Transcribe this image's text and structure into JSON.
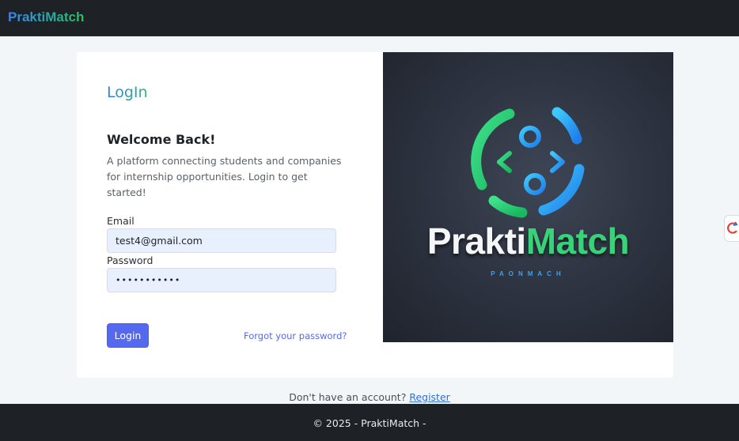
{
  "navbar": {
    "brand": "PraktiMatch"
  },
  "login": {
    "title": "LogIn",
    "welcome": "Welcome Back!",
    "description": "A platform connecting students and companies for internship opportunities. Login to get started!",
    "email_label": "Email",
    "email_value": "test4@gmail.com",
    "password_label": "Password",
    "password_value": "•••••••••••",
    "login_button": "Login",
    "forgot_link": "Forgot your password?"
  },
  "hero": {
    "name_prefix": "Prakti",
    "name_suffix": "Match",
    "tagline": "PAONMACH"
  },
  "register": {
    "prompt": "Don't have an account? ",
    "link": "Register"
  },
  "footer": {
    "text": "© 2025 - PraktiMatch -"
  },
  "colors": {
    "accent": "#5468f0",
    "brand_blue": "#3b82f6",
    "brand_green": "#22c55e",
    "navbar_bg": "#1e2125"
  },
  "icons": {
    "logo": "praktimatch-logo-icon",
    "side_widget": "refresh-widget-icon"
  }
}
